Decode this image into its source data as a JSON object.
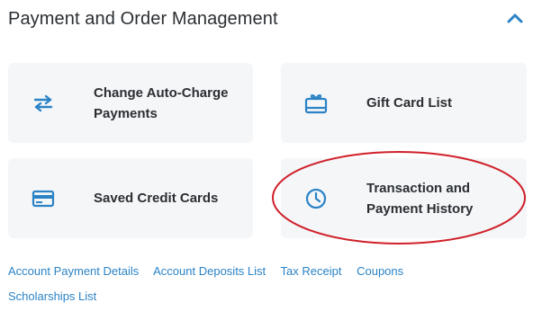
{
  "section": {
    "title": "Payment and Order Management",
    "collapse_icon": "chevron-up-icon"
  },
  "colors": {
    "accent": "#2b83c6",
    "card_bg": "#f4f6f8",
    "text": "#2b2f33",
    "annotation": "#d0202a"
  },
  "cards": [
    {
      "label": "Change Auto-Charge Payments",
      "icon": "swap-arrows-icon"
    },
    {
      "label": "Gift Card List",
      "icon": "gift-card-icon"
    },
    {
      "label": "Saved Credit Cards",
      "icon": "credit-card-icon"
    },
    {
      "label": "Transaction and Payment History",
      "icon": "clock-icon"
    }
  ],
  "links": [
    "Account Payment Details",
    "Account Deposits List",
    "Tax Receipt",
    "Coupons",
    "Scholarships List"
  ]
}
